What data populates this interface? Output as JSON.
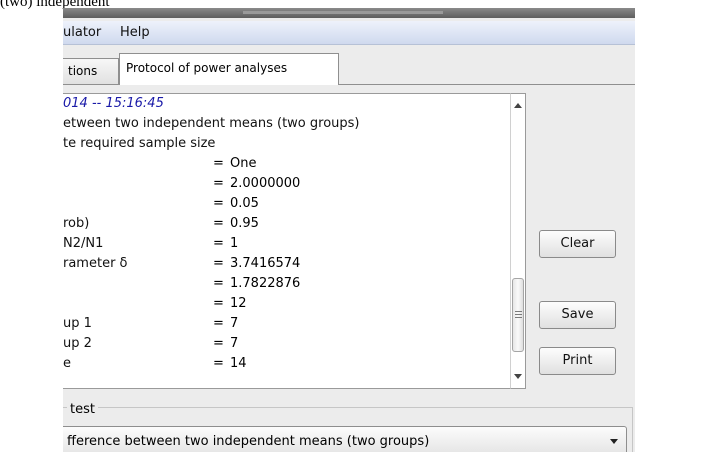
{
  "top_text": "(two) independent",
  "menu": {
    "items": [
      "ulator",
      "Help"
    ]
  },
  "tabs": [
    {
      "label": "tions",
      "active": false
    },
    {
      "label": "Protocol of power analyses",
      "active": true
    }
  ],
  "protocol": {
    "header": "014 -- 15:16:45",
    "lines": [
      "etween two independent means (two groups)",
      "te required sample size"
    ],
    "rows": [
      {
        "label": "",
        "value": "One"
      },
      {
        "label": "",
        "value": "2.0000000"
      },
      {
        "label": "",
        "value": "0.05"
      },
      {
        "label": "rob)",
        "value": "0.95"
      },
      {
        "label": "N2/N1",
        "value": "1"
      },
      {
        "label": "rameter δ",
        "value": "3.7416574"
      },
      {
        "label": "",
        "value": "1.7822876"
      },
      {
        "label": "",
        "value": "12"
      },
      {
        "label": "up 1",
        "value": "7"
      },
      {
        "label": "up 2",
        "value": "7"
      },
      {
        "label": "e",
        "value": "14"
      }
    ],
    "eq": "="
  },
  "buttons": {
    "clear": "Clear",
    "save": "Save",
    "print": "Print"
  },
  "test_group": {
    "label": "test",
    "selected": "fference between two independent means (two groups)"
  }
}
